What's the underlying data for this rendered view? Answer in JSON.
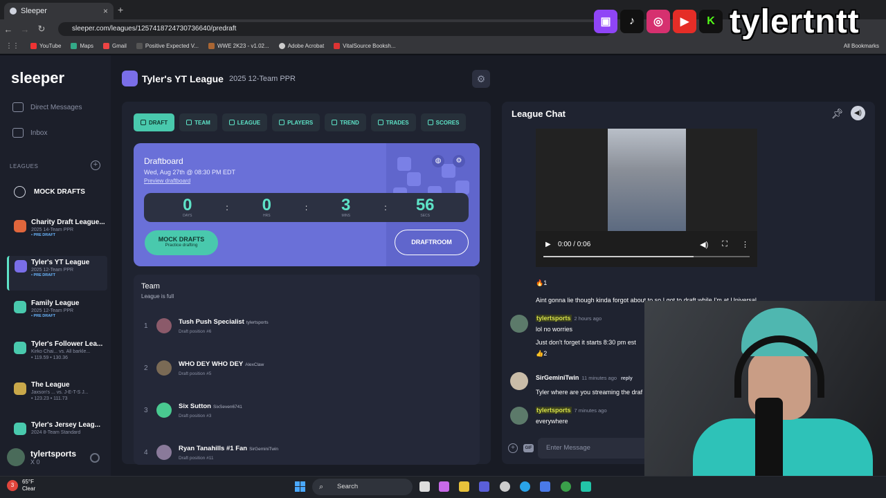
{
  "browser": {
    "tab_title": "Sleeper",
    "tab_close": "×",
    "new_tab": "+",
    "url": "sleeper.com/leagues/1257418724730736640/predraft",
    "bookmarks": [
      "YouTube",
      "Maps",
      "Gmail",
      "Positive Expected V...",
      "WWE 2K23 - v1.02...",
      "Adobe Acrobat",
      "VitalSource Booksh..."
    ],
    "all_bookmarks": "All Bookmarks"
  },
  "overlay": {
    "brand_name": "tylertntt",
    "socials": [
      "twitch-icon",
      "tiktok-icon",
      "instagram-icon",
      "youtube-icon",
      "kick-icon"
    ]
  },
  "sidebar": {
    "logo": "sleeper",
    "direct_messages": "Direct Messages",
    "inbox": "Inbox",
    "leagues_header": "LEAGUES",
    "mock_drafts": "MOCK DRAFTS",
    "leagues": [
      {
        "title": "Charity Draft League...",
        "sub": "2025 14-Team PPR",
        "status": "• PRE DRAFT",
        "color": "#e0663c"
      },
      {
        "title": "Tyler's YT League",
        "sub": "2025 12-Team PPR",
        "status": "• PRE DRAFT",
        "color": "#7a6ee8"
      },
      {
        "title": "Family League",
        "sub": "2025 12-Team PPR",
        "status": "• PRE DRAFT",
        "color": "#49c9ad"
      },
      {
        "title": "Tyler's Follower Lea...",
        "sub": "Kirko Chai...    vs.    All barkle...",
        "status": "• 119.59                    • 130.36",
        "color": "#49c9ad"
      },
      {
        "title": "The League",
        "sub": "Jaxson's ...    vs.    J-E-T-S J...",
        "status": "• 123.23                    • 111.73",
        "color": "#c9a84a"
      },
      {
        "title": "Tyler's Jersey Leag...",
        "sub": "2024 8-Team Standard",
        "status": "",
        "color": "#49c9ad"
      }
    ],
    "user": {
      "name": "tylertsports",
      "sub": "X 0"
    }
  },
  "header": {
    "league_name": "Tyler's YT League",
    "league_sub": "2025 12-Team PPR"
  },
  "tabs": [
    "DRAFT",
    "TEAM",
    "LEAGUE",
    "PLAYERS",
    "TREND",
    "TRADES",
    "SCORES"
  ],
  "draftboard": {
    "title": "Draftboard",
    "date": "Wed, Aug 27th @ 08:30 PM EDT",
    "preview": "Preview draftboard",
    "countdown": [
      {
        "value": "0",
        "label": "DAYS"
      },
      {
        "value": "0",
        "label": "HRS"
      },
      {
        "value": "3",
        "label": "MINS"
      },
      {
        "value": "56",
        "label": "SECS"
      }
    ],
    "colon": ":",
    "mock_btn": "MOCK DRAFTS",
    "mock_btn_sub": "Practice drafting",
    "draftroom_btn": "DRAFTROOM"
  },
  "team": {
    "title": "Team",
    "sub": "League is full",
    "rows": [
      {
        "num": "1",
        "name": "Tush Push Specialist",
        "user": "tylertsports",
        "pos": "Draft position #6"
      },
      {
        "num": "2",
        "name": "WHO DEY WHO DEY",
        "user": "AlexClaw",
        "pos": "Draft position #5"
      },
      {
        "num": "3",
        "name": "Six Sutton",
        "user": "SixSeven6741",
        "pos": "Draft position #3"
      },
      {
        "num": "4",
        "name": "Ryan Tanahills #1 Fan",
        "user": "SirGeminiTwin",
        "pos": "Draft position #11"
      }
    ]
  },
  "chat": {
    "title": "League Chat",
    "video_time": "0:00 / 0:06",
    "reaction1": "🔥1",
    "msg1": "Aint gonna lie though kinda forgot about to so I got to draft while I'm at Universal",
    "m2_user": "tylertsports",
    "m2_time": "2 hours ago",
    "m2_line1": "lol no worries",
    "m2_line2": "Just don't forget it starts 8:30 pm est",
    "reaction2": "👍2",
    "m3_user": "SirGeminiTwin",
    "m3_time": "11 minutes ago",
    "m3_reply": "reply",
    "m3_text": "Tyler where are you streaming the draf",
    "m4_user": "tylertsports",
    "m4_time": "7 minutes ago",
    "m4_text": "everywhere",
    "input_placeholder": "Enter Message",
    "gif": "GIF"
  },
  "taskbar": {
    "temp": "65°F",
    "weather": "Clear",
    "search": "Search",
    "badge": "3"
  }
}
